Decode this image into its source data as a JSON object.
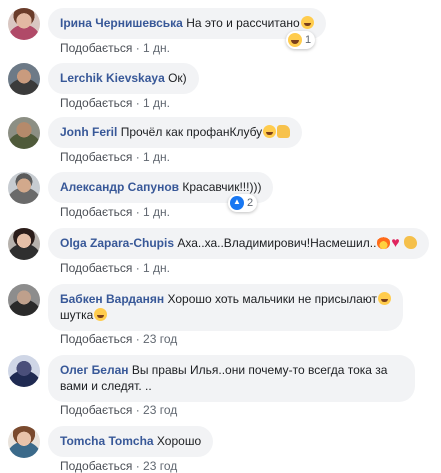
{
  "comments": [
    {
      "author": "Ірина Чернишевська",
      "text": "На это и рассчитано",
      "like": "Подобається",
      "time": "1 дн.",
      "reaction_count": "1"
    },
    {
      "author": "Lerchik Kievskaya",
      "text": "Ок)",
      "like": "Подобається",
      "time": "1 дн."
    },
    {
      "author": "Jonh Feril",
      "text": "Прочёл как профанКлубу",
      "like": "Подобається",
      "time": "1 дн."
    },
    {
      "author": "Александр Сапунов",
      "text": "Красавчик!!!)))",
      "like": "Подобається",
      "time": "1 дн.",
      "reaction_count": "2"
    },
    {
      "author": "Olga Zapara-Chupis",
      "text": "Аха..ха..Владимирович!Насмешил..",
      "like": "Подобається",
      "time": "1 дн."
    },
    {
      "author": "Бабкен Варданян",
      "text_line1": "Хорошо хоть мальчики не присылают",
      "text_line2": "шутка",
      "like": "Подобається",
      "time": "23 год"
    },
    {
      "author": "Олег Белан",
      "text": "Вы правы Илья..они почему-то всегда тока за вами и следят. ..",
      "like": "Подобається",
      "time": "23 год"
    },
    {
      "author": "Tomcha Tomcha",
      "text": "Хорошо",
      "like": "Подобається",
      "time": "23 год"
    }
  ],
  "separator": " · ",
  "icons": {
    "avatar": "avatar",
    "laugh": "laughing-emoji",
    "thumbs": "thumbs-up-emoji",
    "heart": "heart-emoji",
    "fire": "fire-emoji",
    "clap": "clapping-emoji",
    "like_reaction": "like-reaction-icon"
  }
}
